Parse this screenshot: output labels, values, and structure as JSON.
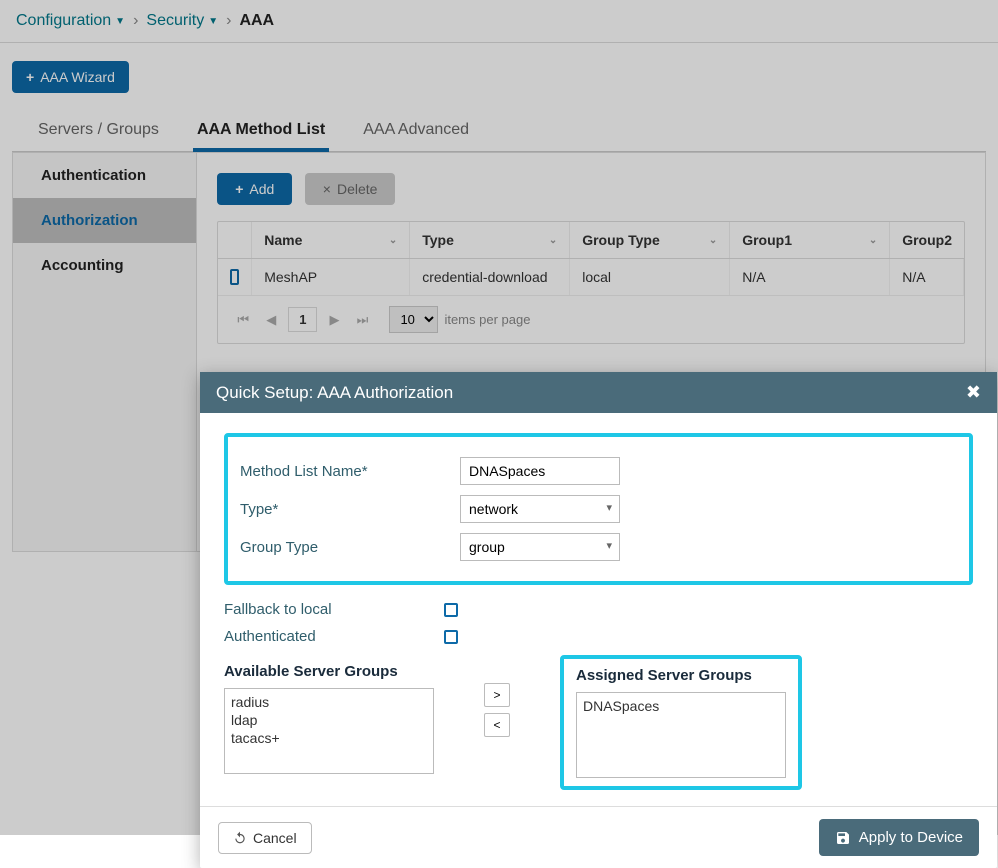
{
  "breadcrumb": {
    "a": "Configuration",
    "b": "Security",
    "c": "AAA"
  },
  "wizard_btn": "AAA Wizard",
  "tabs": {
    "t0": "Servers / Groups",
    "t1": "AAA Method List",
    "t2": "AAA Advanced"
  },
  "side": {
    "s0": "Authentication",
    "s1": "Authorization",
    "s2": "Accounting"
  },
  "toolbar": {
    "add": "Add",
    "delete": "Delete"
  },
  "grid": {
    "h_name": "Name",
    "h_type": "Type",
    "h_gtype": "Group Type",
    "h_g1": "Group1",
    "h_g2": "Group2",
    "r0": {
      "name": "MeshAP",
      "type": "credential-download",
      "gtype": "local",
      "g1": "N/A",
      "g2": "N/A"
    }
  },
  "pager": {
    "page": "1",
    "size": "10",
    "label": "items per page"
  },
  "modal": {
    "title": "Quick Setup: AAA Authorization",
    "l_name": "Method List Name*",
    "v_name": "DNASpaces",
    "l_type": "Type*",
    "v_type": "network",
    "l_gtype": "Group Type",
    "v_gtype": "group",
    "l_fallback": "Fallback to local",
    "l_auth": "Authenticated",
    "l_avail": "Available Server Groups",
    "l_assigned": "Assigned Server Groups",
    "avail": {
      "a0": "radius",
      "a1": "ldap",
      "a2": "tacacs+"
    },
    "assigned": {
      "a0": "DNASpaces"
    },
    "cancel": "Cancel",
    "apply": "Apply to Device"
  }
}
